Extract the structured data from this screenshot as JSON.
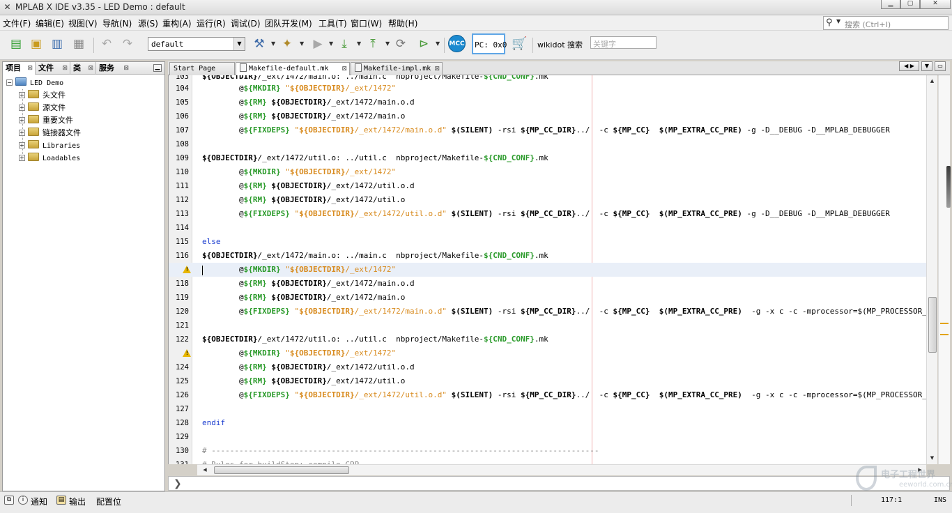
{
  "window": {
    "title": "MPLAB X IDE v3.35 - LED Demo : default"
  },
  "menu": [
    "文件(F)",
    "编辑(E)",
    "视图(V)",
    "导航(N)",
    "源(S)",
    "重构(A)",
    "运行(R)",
    "调试(D)",
    "团队开发(M)",
    "工具(T)",
    "窗口(W)",
    "帮助(H)"
  ],
  "search": {
    "placeholder": "搜索 (Ctrl+I)"
  },
  "toolbar": {
    "config_value": "default",
    "mcc_label": "MCC",
    "pc_readout": "PC: 0x0",
    "wiki_label": "wikidot 搜索",
    "wiki_placeholder": "关键字"
  },
  "left_panel": {
    "tabs": [
      "项目",
      "文件",
      "类",
      "服务"
    ],
    "tree": {
      "root": "LED Demo",
      "children": [
        "头文件",
        "源文件",
        "重要文件",
        "链接器文件",
        "Libraries",
        "Loadables"
      ]
    }
  },
  "editor": {
    "tabs": [
      "Start Page",
      "Makefile-default.mk",
      "Makefile-impl.mk"
    ],
    "current_line": 117,
    "line_numbers": [
      "103",
      "104",
      "105",
      "106",
      "107",
      "108",
      "109",
      "110",
      "111",
      "112",
      "113",
      "114",
      "115",
      "116",
      "117",
      "118",
      "119",
      "120",
      "121",
      "122",
      "123",
      "124",
      "125",
      "126",
      "127",
      "128",
      "129",
      "130",
      "131"
    ]
  },
  "statusbar": {
    "items": [
      "通知",
      "输出",
      "配置位"
    ],
    "position": "117:1",
    "mode": "INS"
  },
  "watermark": {
    "text": "电子工程世界",
    "sub": "eeworld.com.cn"
  },
  "colors": {
    "keyword_green": "#2a9a2a",
    "string_orange": "#d88b1f",
    "keyword_blue": "#1a3ccf",
    "warning": "#e8b600"
  }
}
